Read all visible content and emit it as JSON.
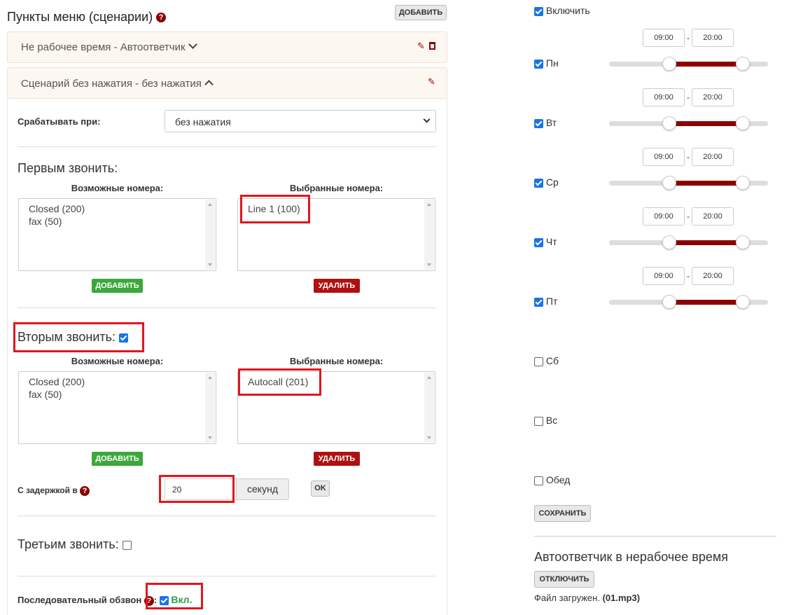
{
  "header": {
    "title": "Пункты меню (сценарии)",
    "add_label": "ДОБАВИТЬ"
  },
  "menu_items": [
    {
      "title": "Не рабочее время - Автоответчик",
      "expanded": false
    },
    {
      "title": "Сценарий без нажатия - без нажатия",
      "expanded": true
    }
  ],
  "trigger": {
    "label": "Срабатывать при:",
    "value": "без нажатия"
  },
  "first_call": {
    "title": "Первым звонить:",
    "available_label": "Возможные номера:",
    "selected_label": "Выбранные номера:",
    "available": [
      "Closed (200)",
      "fax (50)"
    ],
    "selected": [
      "Line 1 (100)"
    ],
    "add_label": "ДОБАВИТЬ",
    "remove_label": "УДАЛИТЬ"
  },
  "second_call": {
    "title": "Вторым звонить:",
    "enabled": true,
    "available_label": "Возможные номера:",
    "selected_label": "Выбранные номера:",
    "available": [
      "Closed (200)",
      "fax (50)"
    ],
    "selected": [
      "Autocall (201)"
    ],
    "add_label": "ДОБАВИТЬ",
    "remove_label": "УДАЛИТЬ",
    "delay_label": "С задержкой в",
    "delay_value": "20",
    "delay_unit": "секунд",
    "ok_label": "OK"
  },
  "third_call": {
    "title": "Третьим звонить:",
    "enabled": false
  },
  "sequential": {
    "label": "Последовательный обзвон",
    "state_label": "Вкл.",
    "enabled": true
  },
  "schedule": {
    "enable_label": "Включить",
    "enabled": true,
    "days": [
      {
        "label": "Пн",
        "checked": true,
        "from": "09:00",
        "to": "20:00"
      },
      {
        "label": "Вт",
        "checked": true,
        "from": "09:00",
        "to": "20:00"
      },
      {
        "label": "Ср",
        "checked": true,
        "from": "09:00",
        "to": "20:00"
      },
      {
        "label": "Чт",
        "checked": true,
        "from": "09:00",
        "to": "20:00"
      },
      {
        "label": "Пт",
        "checked": true,
        "from": "09:00",
        "to": "20:00"
      },
      {
        "label": "Сб",
        "checked": false
      },
      {
        "label": "Вс",
        "checked": false
      },
      {
        "label": "Обед",
        "checked": false
      }
    ],
    "save_label": "СОХРАНИТЬ"
  },
  "autoresponder": {
    "title": "Автоответчик в нерабочее время",
    "disable_label": "ОТКЛЮЧИТЬ",
    "file_text": "Файл загружен.",
    "file_name": "(01.mp3)"
  },
  "colors": {
    "accent": "#8b0000",
    "green": "#3aa83a",
    "red": "#b01010",
    "highlight": "#e0161e"
  }
}
